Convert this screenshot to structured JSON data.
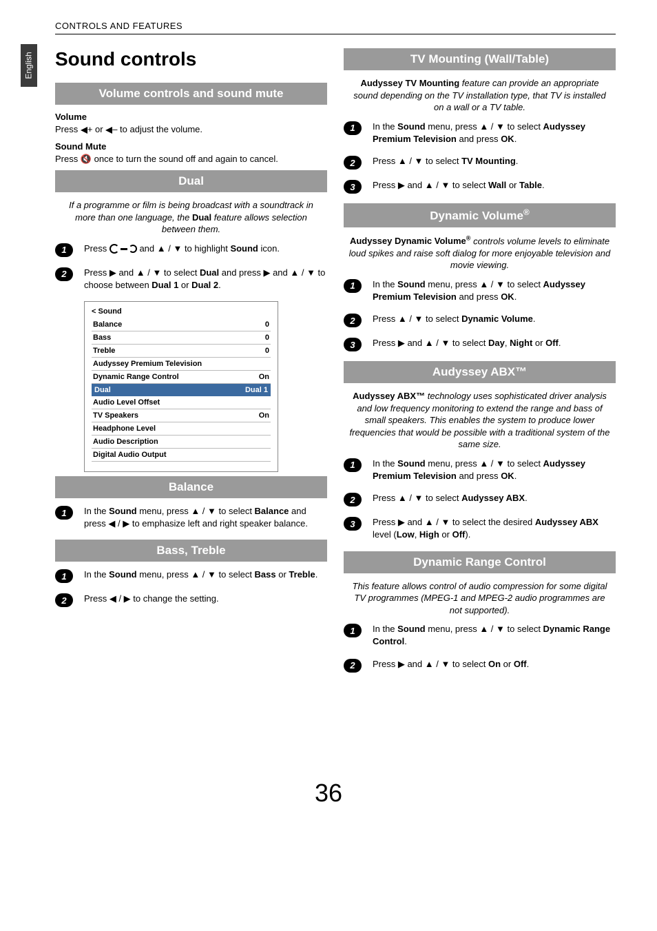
{
  "header": "CONTROLS AND FEATURES",
  "side_tab": "English",
  "page_number": "36",
  "left": {
    "title": "Sound controls",
    "sec1": {
      "bar": "Volume controls and sound mute",
      "vol_label": "Volume",
      "vol_text_pre": "Press ",
      "vol_text_post": "+ or ",
      "vol_text_post2": "– to adjust the volume.",
      "mute_label": "Sound Mute",
      "mute_text_pre": "Press ",
      "mute_text_post": " once to turn the sound off and again to cancel."
    },
    "sec2": {
      "bar": "Dual",
      "intro_pre": "If a programme or film is being broadcast with a soundtrack in more than one language, the ",
      "intro_bold": "Dual",
      "intro_post": " feature allows selection between them.",
      "step1_pre": "Press ",
      "step1_mid": " and ▲ / ▼ to highlight ",
      "step1_bold": "Sound",
      "step1_post": " icon.",
      "step2_a": "Press ▶ and ▲ / ▼ to select ",
      "step2_b": "Dual",
      "step2_c": " and press ▶ and ▲ / ▼ to choose between ",
      "step2_d": "Dual 1",
      "step2_e": " or ",
      "step2_f": "Dual 2",
      "step2_g": "."
    },
    "menu": {
      "title": "< Sound",
      "rows": [
        {
          "label": "Balance",
          "value": "0"
        },
        {
          "label": "Bass",
          "value": "0"
        },
        {
          "label": "Treble",
          "value": "0"
        },
        {
          "label": "Audyssey Premium Television",
          "value": ""
        },
        {
          "label": "Dynamic Range Control",
          "value": "On"
        },
        {
          "label": "Dual",
          "value": "Dual 1",
          "selected": true
        },
        {
          "label": "Audio Level Offset",
          "value": ""
        },
        {
          "label": "TV Speakers",
          "value": "On"
        },
        {
          "label": "Headphone Level",
          "value": ""
        },
        {
          "label": "Audio Description",
          "value": ""
        },
        {
          "label": "Digital Audio Output",
          "value": ""
        }
      ]
    },
    "sec3": {
      "bar": "Balance",
      "step1_a": "In the ",
      "step1_b": "Sound",
      "step1_c": " menu, press ▲ / ▼ to select ",
      "step1_d": "Balance",
      "step1_e": " and press ◀ / ▶ to emphasize left and right speaker balance."
    },
    "sec4": {
      "bar": "Bass, Treble",
      "step1_a": "In the ",
      "step1_b": "Sound",
      "step1_c": " menu, press ▲ / ▼ to select ",
      "step1_d": "Bass",
      "step1_e": " or ",
      "step1_f": "Treble",
      "step1_g": ".",
      "step2": "Press ◀ / ▶ to change the setting."
    }
  },
  "right": {
    "sec1": {
      "bar": "TV Mounting (Wall/Table)",
      "intro_b": "Audyssey TV Mounting",
      "intro_post": " feature can provide an appropriate sound depending on the TV installation type, that TV is installed on a wall or a TV table.",
      "s1a": "In the ",
      "s1b": "Sound",
      "s1c": " menu, press ▲ / ▼ to select ",
      "s1d": "Audyssey Premium Television",
      "s1e": " and press ",
      "s1f": "OK",
      "s1g": ".",
      "s2a": "Press ▲ / ▼ to select ",
      "s2b": "TV Mounting",
      "s2c": ".",
      "s3a": "Press ▶ and ▲ / ▼ to select ",
      "s3b": "Wall",
      "s3c": " or ",
      "s3d": "Table",
      "s3e": "."
    },
    "sec2": {
      "bar_html": "Dynamic Volume®",
      "intro_b": "Audyssey Dynamic Volume®",
      "intro_post": " controls volume levels to eliminate loud spikes and raise soft dialog for more enjoyable television and movie viewing.",
      "s1a": "In the ",
      "s1b": "Sound",
      "s1c": " menu, press ▲ / ▼ to select ",
      "s1d": "Audyssey Premium Television",
      "s1e": " and press ",
      "s1f": "OK",
      "s1g": ".",
      "s2a": "Press ▲ / ▼ to select ",
      "s2b": "Dynamic Volume",
      "s2c": ".",
      "s3a": "Press ▶ and ▲ / ▼ to select ",
      "s3b": "Day",
      "s3c": ", ",
      "s3d": "Night",
      "s3e": " or ",
      "s3f": "Off",
      "s3g": "."
    },
    "sec3": {
      "bar": "Audyssey ABX™",
      "intro_b": "Audyssey ABX™",
      "intro_post": " technology uses sophisticated driver analysis and low frequency monitoring to extend the range and bass of small speakers. This enables the system to produce lower frequencies that would be possible with a traditional system of the same size.",
      "s1a": "In the ",
      "s1b": "Sound",
      "s1c": " menu, press ▲ / ▼ to select ",
      "s1d": "Audyssey Premium Television",
      "s1e": " and press ",
      "s1f": "OK",
      "s1g": ".",
      "s2a": "Press ▲ / ▼ to select ",
      "s2b": "Audyssey ABX",
      "s2c": ".",
      "s3a": "Press ▶ and ▲ / ▼ to select the desired ",
      "s3b": "Audyssey ABX",
      "s3c": " level (",
      "s3d": "Low",
      "s3e": ", ",
      "s3f": "High",
      "s3g": " or ",
      "s3h": "Off",
      "s3i": ")."
    },
    "sec4": {
      "bar": "Dynamic Range Control",
      "intro": "This feature allows control of audio compression for some digital TV programmes (MPEG-1 and MPEG-2 audio programmes are not supported).",
      "s1a": "In the ",
      "s1b": "Sound",
      "s1c": " menu, press ▲ / ▼ to select ",
      "s1d": "Dynamic Range Control",
      "s1e": ".",
      "s2a": "Press ▶ and ▲ / ▼ to select ",
      "s2b": "On",
      "s2c": " or ",
      "s2d": "Off",
      "s2e": "."
    }
  }
}
